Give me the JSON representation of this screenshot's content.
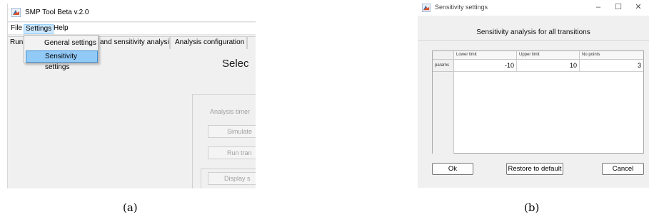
{
  "main_window": {
    "title": "SMP Tool Beta v.2.0",
    "menu": [
      "File",
      "Settings",
      "Help"
    ],
    "active_menu": "Settings",
    "tabs": [
      "Run",
      "and sensitivity analysis",
      "Analysis configuration"
    ],
    "dropdown": {
      "items": [
        "General settings",
        "Sensitivity settings"
      ],
      "highlighted": "Sensitivity settings"
    },
    "heading": "Selec",
    "group_text": "Analysis timer",
    "buttons": [
      "Simulate",
      "Run tran",
      "Display s"
    ]
  },
  "sensitivity_dialog": {
    "title": "Sensitivity settings",
    "window_controls": [
      "–",
      "☐",
      "✕"
    ],
    "subtitle": "Sensitivity analysis for all transitions",
    "table": {
      "columns": [
        "Lower limit",
        "Upper limit",
        "No points"
      ],
      "rows": [
        {
          "label": "params",
          "values": [
            "-10",
            "10",
            "3"
          ]
        }
      ]
    },
    "buttons": {
      "ok": "Ok",
      "restore": "Restore to default",
      "cancel": "Cancel"
    }
  },
  "captions": [
    "(a)",
    "(b)"
  ],
  "colors": {
    "menu_highlight": "#cce8ff",
    "dropdown_highlight": "#91c9f7",
    "window_bg": "#f0f0f0"
  }
}
